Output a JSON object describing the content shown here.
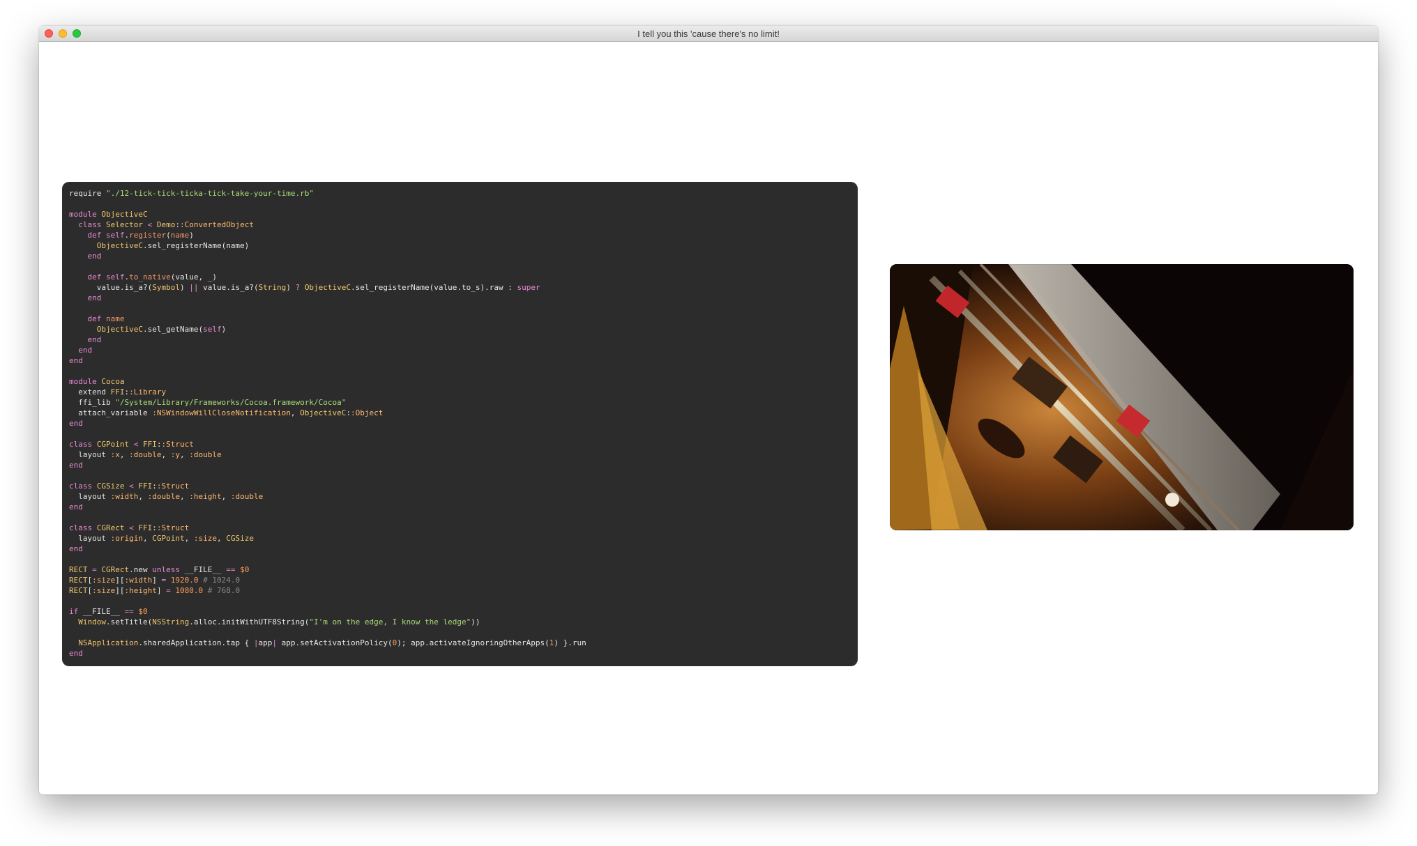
{
  "window": {
    "title": "I tell you this 'cause there's no limit!",
    "controls": [
      "close",
      "minimize",
      "zoom"
    ]
  },
  "code": {
    "language": "ruby",
    "lines": [
      "require \"./12-tick-tick-ticka-tick-take-your-time.rb\"",
      "",
      "module ObjectiveC",
      "  class Selector < Demo::ConvertedObject",
      "    def self.register(name)",
      "      ObjectiveC.sel_registerName(name)",
      "    end",
      "",
      "    def self.to_native(value, _)",
      "      value.is_a?(Symbol) || value.is_a?(String) ? ObjectiveC.sel_registerName(value.to_s).raw : super",
      "    end",
      "",
      "    def name",
      "      ObjectiveC.sel_getName(self)",
      "    end",
      "  end",
      "end",
      "",
      "module Cocoa",
      "  extend FFI::Library",
      "  ffi_lib \"/System/Library/Frameworks/Cocoa.framework/Cocoa\"",
      "  attach_variable :NSWindowWillCloseNotification, ObjectiveC::Object",
      "end",
      "",
      "class CGPoint < FFI::Struct",
      "  layout :x, :double, :y, :double",
      "end",
      "",
      "class CGSize < FFI::Struct",
      "  layout :width, :double, :height, :double",
      "end",
      "",
      "class CGRect < FFI::Struct",
      "  layout :origin, CGPoint, :size, CGSize",
      "end",
      "",
      "RECT = CGRect.new unless __FILE__ == $0",
      "RECT[:size][:width] = 1920.0 # 1024.0",
      "RECT[:size][:height] = 1080.0 # 768.0",
      "",
      "if __FILE__ == $0",
      "  Window.setTitle(NSString.alloc.initWithUTF8String(\"I'm on the edge, I know the ledge\"))",
      "",
      "  NSApplication.sharedApplication.tap { |app| app.setActivationPolicy(0); app.activateIgnoringOtherApps(1) }.run",
      "end"
    ]
  },
  "video": {
    "icon": "video-frame"
  },
  "colors": {
    "code_background": "#2c2c2d",
    "keyword": "#e98ad3",
    "constant": "#f2c76b",
    "string": "#a9dc76",
    "symbol": "#ffb86c",
    "number": "#ff9f5a",
    "comment": "#8a8a8a"
  }
}
